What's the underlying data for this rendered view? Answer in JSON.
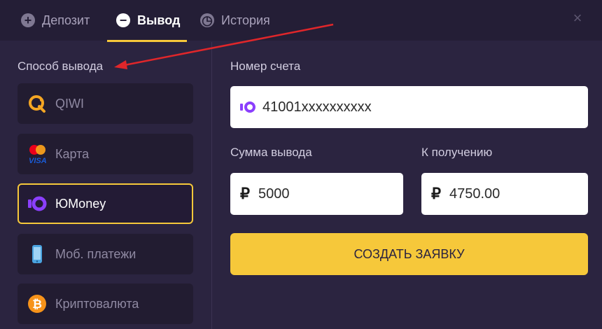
{
  "tabs": [
    {
      "label": "Депозит",
      "icon": "plus-circle-icon",
      "glyph": "+"
    },
    {
      "label": "Вывод",
      "icon": "minus-circle-icon",
      "glyph": "−"
    },
    {
      "label": "История",
      "icon": "clock-icon",
      "glyph": "◷"
    }
  ],
  "close_label": "×",
  "method_section": {
    "label": "Способ вывода"
  },
  "methods": [
    {
      "label": "QIWI",
      "icon": "qiwi-logo-icon"
    },
    {
      "label": "Карта",
      "icon": "mastercard-visa-icon"
    },
    {
      "label": "ЮMoney",
      "icon": "yoomoney-logo-icon"
    },
    {
      "label": "Моб. платежи",
      "icon": "mobile-phone-icon"
    },
    {
      "label": "Криптовалюта",
      "icon": "bitcoin-icon"
    }
  ],
  "account": {
    "label": "Номер счета",
    "value": "41001xxxxxxxxxx"
  },
  "amount": {
    "label": "Сумма вывода",
    "currency": "₽",
    "value": "5000"
  },
  "receive": {
    "label": "К получению",
    "currency": "₽",
    "value": "4750.00"
  },
  "submit_label": "СОЗДАТЬ ЗАЯВКУ",
  "colors": {
    "accent": "#f6c83a",
    "background": "#2b2440",
    "annotation_arrow": "#e0262a"
  }
}
